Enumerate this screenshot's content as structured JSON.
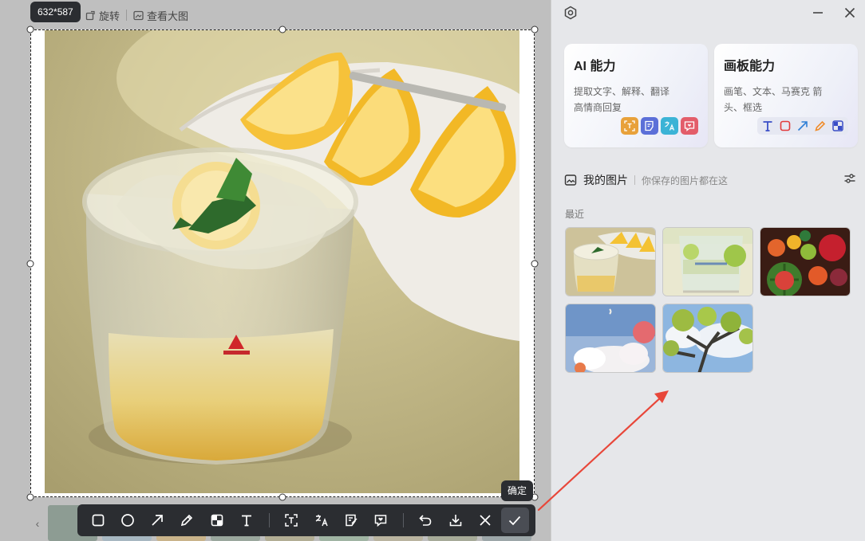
{
  "viewer": {
    "size_badge": "632*587",
    "toolbar": {
      "rotate_label": "旋转",
      "view_large_label": "查看大图"
    },
    "confirm_tooltip": "确定",
    "edit_tools": [
      {
        "name": "rectangle-tool",
        "icon": "rectangle-icon"
      },
      {
        "name": "ellipse-tool",
        "icon": "circle-icon"
      },
      {
        "name": "arrow-tool",
        "icon": "arrow-icon"
      },
      {
        "name": "pencil-tool",
        "icon": "pencil-icon"
      },
      {
        "name": "mosaic-tool",
        "icon": "mosaic-icon"
      },
      {
        "name": "text-tool",
        "icon": "text-icon"
      },
      {
        "name": "ocr-tool",
        "icon": "scan-text-icon"
      },
      {
        "name": "translate-tool",
        "icon": "translate-icon"
      },
      {
        "name": "explain-tool",
        "icon": "explain-icon"
      },
      {
        "name": "eq-reply-tool",
        "icon": "chat-icon"
      },
      {
        "name": "undo-button",
        "icon": "undo-icon"
      },
      {
        "name": "download-button",
        "icon": "download-icon"
      },
      {
        "name": "cancel-button",
        "icon": "close-icon"
      },
      {
        "name": "confirm-button",
        "icon": "check-icon"
      }
    ]
  },
  "panel": {
    "ai_card": {
      "title": "AI 能力",
      "desc": "提取文字、解释、翻译 高情商回复",
      "icon_colors": [
        "#e8a13a",
        "#5b6fd8",
        "#3bb3d6",
        "#e35d6a"
      ]
    },
    "board_card": {
      "title": "画板能力",
      "desc": "画笔、文本、马赛克 箭头、框选",
      "icon_colors": [
        "#3a4ec7",
        "#e23a3a",
        "#2f7fd6",
        "#f08c2a",
        "#3a4ec7"
      ]
    },
    "my_pictures": {
      "title": "我的图片",
      "subtitle": "你保存的图片都在这",
      "recent_label": "最近"
    }
  },
  "colors": {
    "accent_arrow": "#e8473a",
    "toolbar_bg": "#2b2d31"
  }
}
